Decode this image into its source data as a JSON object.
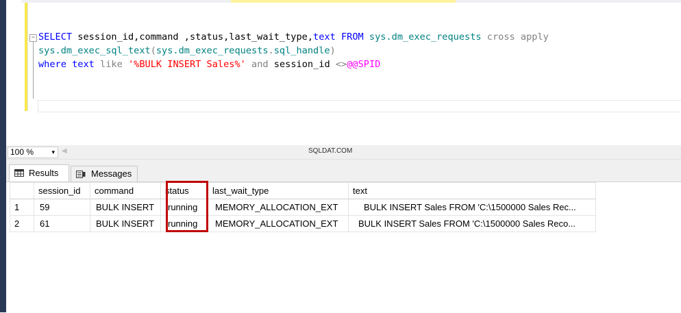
{
  "editor": {
    "lines": [
      {
        "tokens": [
          {
            "text": "SELECT",
            "cls": "kw"
          },
          {
            "text": " session_id,command ,status,last_wait_type,",
            "cls": "bk"
          },
          {
            "text": "text",
            "cls": "kw"
          },
          {
            "text": " ",
            "cls": "bk"
          },
          {
            "text": "FROM",
            "cls": "kw"
          },
          {
            "text": " ",
            "cls": "bk"
          },
          {
            "text": "sys.dm_exec_requests",
            "cls": "gn"
          },
          {
            "text": " ",
            "cls": "bk"
          },
          {
            "text": "cross apply",
            "cls": "gy"
          }
        ]
      },
      {
        "tokens": [
          {
            "text": "sys.dm_exec_sql_text",
            "cls": "gn"
          },
          {
            "text": "(",
            "cls": "gy"
          },
          {
            "text": "sys.dm_exec_requests",
            "cls": "gn"
          },
          {
            "text": ".",
            "cls": "gy"
          },
          {
            "text": "sql_handle",
            "cls": "gn"
          },
          {
            "text": ")",
            "cls": "gy"
          }
        ]
      },
      {
        "tokens": [
          {
            "text": "where",
            "cls": "kw"
          },
          {
            "text": " ",
            "cls": "bk"
          },
          {
            "text": "text",
            "cls": "kw"
          },
          {
            "text": " ",
            "cls": "bk"
          },
          {
            "text": "like",
            "cls": "gy"
          },
          {
            "text": " ",
            "cls": "bk"
          },
          {
            "text": "'%BULK INSERT Sales%'",
            "cls": "rd"
          },
          {
            "text": " ",
            "cls": "bk"
          },
          {
            "text": "and",
            "cls": "gy"
          },
          {
            "text": " session_id ",
            "cls": "bk"
          },
          {
            "text": "<>",
            "cls": "gy"
          },
          {
            "text": "@@SPID",
            "cls": "mg"
          }
        ]
      }
    ]
  },
  "zoom": {
    "value": "100 %",
    "arrow": "▾"
  },
  "watermark": "SQLDAT.COM",
  "tabs": {
    "results": "Results",
    "messages": "Messages"
  },
  "grid": {
    "columns": [
      "session_id",
      "command",
      "status",
      "last_wait_type",
      "text"
    ],
    "rows": [
      {
        "rownum": "1",
        "session_id": "59",
        "command": "BULK INSERT",
        "status": "running",
        "last_wait_type": "MEMORY_ALLOCATION_EXT",
        "text": "BULK INSERT Sales  FROM 'C:\\1500000 Sales Rec..."
      },
      {
        "rownum": "2",
        "session_id": "61",
        "command": "BULK INSERT",
        "status": "running",
        "last_wait_type": "MEMORY_ALLOCATION_EXT",
        "text": "BULK INSERT Sales  FROM 'C:\\1500000 Sales Reco..."
      }
    ]
  },
  "colors": {
    "frame": "#293955",
    "highlight": "#c00000",
    "editor_margin": "#f7e94d"
  }
}
